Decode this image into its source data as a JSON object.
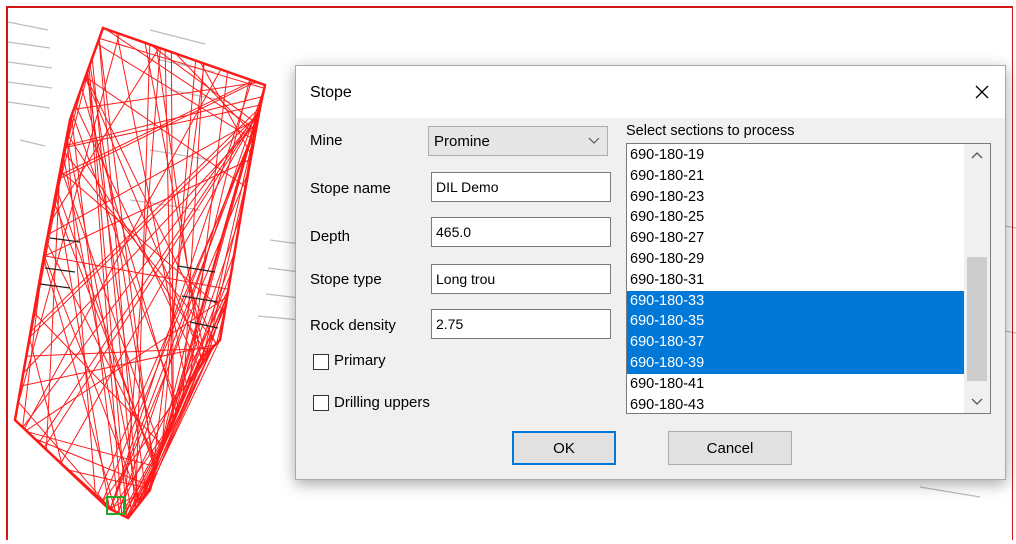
{
  "dialog": {
    "title": "Stope",
    "fields": {
      "mine_label": "Mine",
      "mine_value": "Promine",
      "stope_name_label": "Stope name",
      "stope_name_value": "DIL Demo",
      "depth_label": "Depth",
      "depth_value": "465.0",
      "stope_type_label": "Stope type",
      "stope_type_value": "Long trou",
      "rock_density_label": "Rock density",
      "rock_density_value": "2.75"
    },
    "checkboxes": {
      "primary_label": "Primary",
      "primary_checked": false,
      "drilling_uppers_label": "Drilling uppers",
      "drilling_uppers_checked": false
    },
    "sections": {
      "label": "Select sections to process",
      "items": [
        {
          "label": "690-180-19",
          "selected": false
        },
        {
          "label": "690-180-21",
          "selected": false
        },
        {
          "label": "690-180-23",
          "selected": false
        },
        {
          "label": "690-180-25",
          "selected": false
        },
        {
          "label": "690-180-27",
          "selected": false
        },
        {
          "label": "690-180-29",
          "selected": false
        },
        {
          "label": "690-180-31",
          "selected": false
        },
        {
          "label": "690-180-33",
          "selected": true
        },
        {
          "label": "690-180-35",
          "selected": true
        },
        {
          "label": "690-180-37",
          "selected": true
        },
        {
          "label": "690-180-39",
          "selected": true
        },
        {
          "label": "690-180-41",
          "selected": false
        },
        {
          "label": "690-180-43",
          "selected": false
        }
      ]
    },
    "buttons": {
      "ok_label": "OK",
      "cancel_label": "Cancel"
    }
  },
  "colors": {
    "wireframe": "#ff1a1a",
    "selection": "#0078d7",
    "marker": "#22aa22"
  },
  "icons": {
    "close": "close-icon",
    "dropdown": "chevron-down-icon",
    "scroll_up": "chevron-up-icon",
    "scroll_down": "chevron-down-icon"
  }
}
